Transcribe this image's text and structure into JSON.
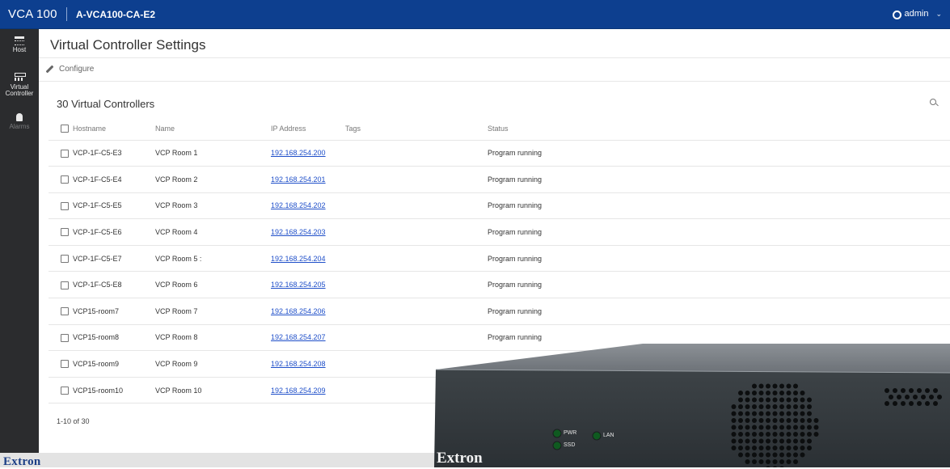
{
  "header": {
    "product": "VCA 100",
    "device": "A-VCA100-CA-E2",
    "user": "admin"
  },
  "sidebar": {
    "items": [
      {
        "label": "Host",
        "icon": "host-icon"
      },
      {
        "label": "Virtual Controller",
        "icon": "virtual-controller-icon"
      },
      {
        "label": "Alarms",
        "icon": "bell-icon"
      }
    ]
  },
  "main": {
    "title": "Virtual Controller Settings",
    "configure_label": "Configure",
    "list_title": "30 Virtual Controllers",
    "columns": {
      "hostname": "Hostname",
      "name": "Name",
      "ip": "IP Address",
      "tags": "Tags",
      "status": "Status"
    },
    "rows": [
      {
        "hostname": "VCP-1F-C5-E3",
        "name": "VCP Room 1",
        "ip": "192.168.254.200",
        "tags": "",
        "status": "Program running"
      },
      {
        "hostname": "VCP-1F-C5-E4",
        "name": "VCP Room 2",
        "ip": "192.168.254.201",
        "tags": "",
        "status": "Program running"
      },
      {
        "hostname": "VCP-1F-C5-E5",
        "name": "VCP Room 3",
        "ip": "192.168.254.202",
        "tags": "",
        "status": "Program running"
      },
      {
        "hostname": "VCP-1F-C5-E6",
        "name": "VCP Room 4",
        "ip": "192.168.254.203",
        "tags": "",
        "status": "Program running"
      },
      {
        "hostname": "VCP-1F-C5-E7",
        "name": "VCP Room 5 :",
        "ip": "192.168.254.204",
        "tags": "",
        "status": "Program running"
      },
      {
        "hostname": "VCP-1F-C5-E8",
        "name": "VCP Room 6",
        "ip": "192.168.254.205",
        "tags": "",
        "status": "Program running"
      },
      {
        "hostname": "VCP15-room7",
        "name": "VCP Room 7",
        "ip": "192.168.254.206",
        "tags": "",
        "status": "Program running"
      },
      {
        "hostname": "VCP15-room8",
        "name": "VCP Room 8",
        "ip": "192.168.254.207",
        "tags": "",
        "status": "Program running"
      },
      {
        "hostname": "VCP15-room9",
        "name": "VCP Room 9",
        "ip": "192.168.254.208",
        "tags": "",
        "status": ""
      },
      {
        "hostname": "VCP15-room10",
        "name": "VCP Room 10",
        "ip": "192.168.254.209",
        "tags": "",
        "status": ""
      }
    ],
    "pagination": "1-10 of 30"
  },
  "footer": {
    "logo": "Extron"
  },
  "hardware": {
    "logo": "Extron",
    "led_pwr": "PWR",
    "led_ssd": "SSD",
    "led_lan": "LAN"
  }
}
